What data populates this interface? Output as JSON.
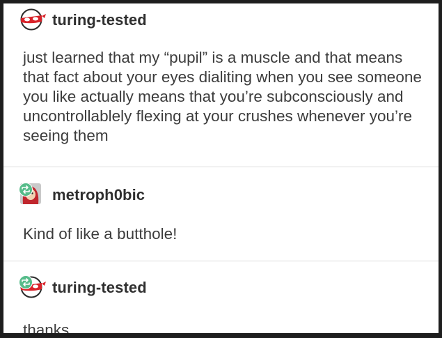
{
  "posts": [
    {
      "username": "turing-tested",
      "avatar_icon": "red-mask-face-icon",
      "reblogged": false,
      "text": "just learned that my “pupil” is a muscle and that means that fact about your eyes dialiting when you see someone you like actually means that you’re subconsciously and uncontrollablely flexing at your crushes whenever you’re seeing them"
    },
    {
      "username": "metroph0bic",
      "avatar_icon": "red-hooded-character-icon",
      "reblogged": true,
      "text": "Kind of like a butthole!"
    },
    {
      "username": "turing-tested",
      "avatar_icon": "red-mask-face-icon",
      "reblogged": true,
      "text": "thanks"
    }
  ],
  "colors": {
    "background": "#ffffff",
    "border": "#1e1e1e",
    "text": "#3c3c3c",
    "divider": "#dcdcdc",
    "reblog_badge": "#56bc8a",
    "avatar_red": "#d8232a"
  }
}
